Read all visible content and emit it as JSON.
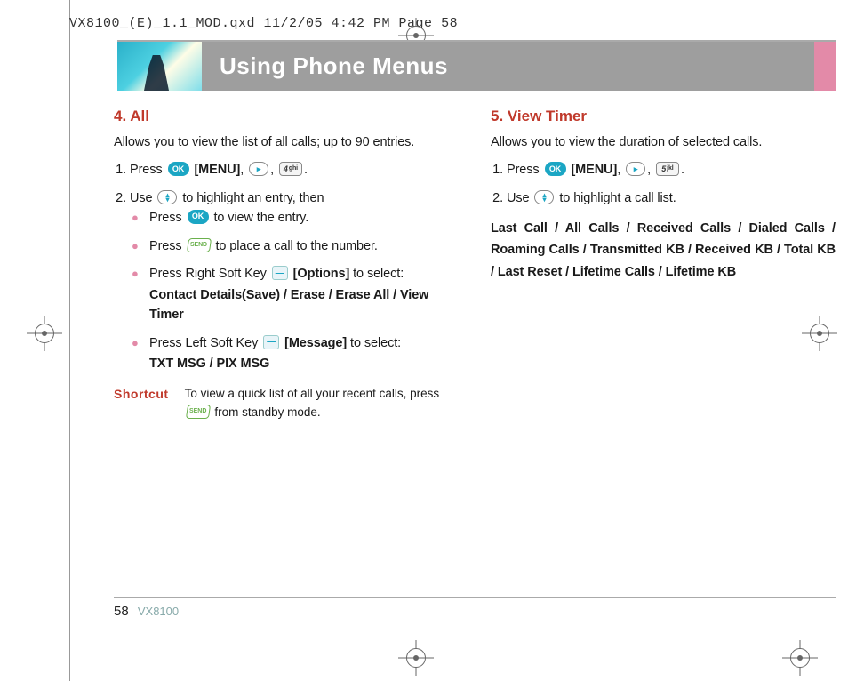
{
  "slug": "VX8100_(E)_1.1_MOD.qxd  11/2/05  4:42 PM  Page 58",
  "banner": {
    "title": "Using Phone Menus"
  },
  "left": {
    "heading": "4. All",
    "intro": "Allows you to view the list of all calls; up to 90 entries.",
    "step1_a": "Press",
    "menu": "[MENU]",
    "comma": ",",
    "period": ".",
    "key4": "4",
    "key4_sup": "ghi",
    "step2_a": "Use",
    "step2_b": "to highlight an entry, then",
    "b1_a": "Press",
    "b1_b": "to view the entry.",
    "b2_a": "Press",
    "b2_b": "to place a call to the number.",
    "b3_a": "Press Right Soft Key",
    "b3_b": "[Options]",
    "b3_c": "to select:",
    "b3_opts": "Contact Details(Save) / Erase / Erase All / View Timer",
    "b4_a": "Press Left Soft Key",
    "b4_b": "[Message]",
    "b4_c": "to select:",
    "b4_opts": "TXT MSG / PIX MSG",
    "shortcut_lbl": "Shortcut",
    "shortcut_a": "To view a quick list of all your recent calls, press",
    "shortcut_b": "from standby mode.",
    "send": "SEND"
  },
  "right": {
    "heading": "5. View Timer",
    "intro": "Allows you to view the duration of selected calls.",
    "step1_a": "Press",
    "menu": "[MENU]",
    "comma": ",",
    "period": ".",
    "key5": "5",
    "key5_sup": "jkl",
    "step2_a": "Use",
    "step2_b": "to highlight a call list.",
    "opts": "Last Call / All Calls / Received Calls / Dialed Calls / Roaming Calls / Transmitted KB / Received KB / Total KB / Last Reset / Lifetime Calls / Lifetime KB"
  },
  "footer": {
    "page": "58",
    "model": "VX8100"
  }
}
